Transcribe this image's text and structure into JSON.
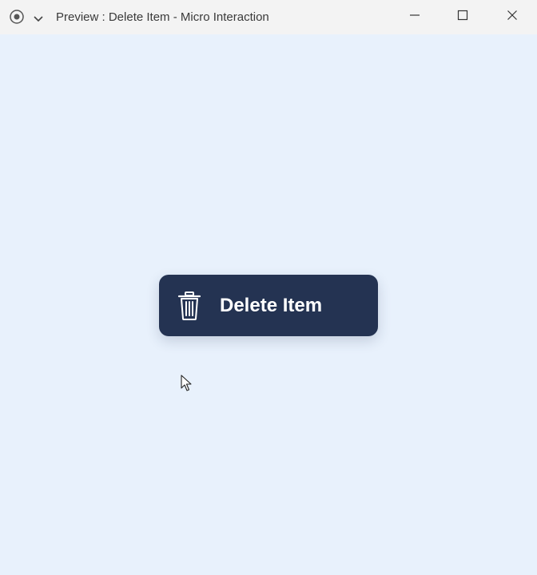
{
  "window": {
    "title": "Preview : Delete Item - Micro Interaction",
    "app_icon": "record-icon",
    "menu_icon": "chevron-down-icon",
    "controls": {
      "minimize_icon": "minimize-icon",
      "maximize_icon": "maximize-icon",
      "close_icon": "close-icon"
    }
  },
  "main": {
    "delete_button": {
      "label": "Delete Item",
      "icon": "trash-icon"
    }
  },
  "colors": {
    "background": "#e8f1fc",
    "titlebar": "#f3f3f3",
    "button": "#243352",
    "button_text": "#ffffff"
  }
}
